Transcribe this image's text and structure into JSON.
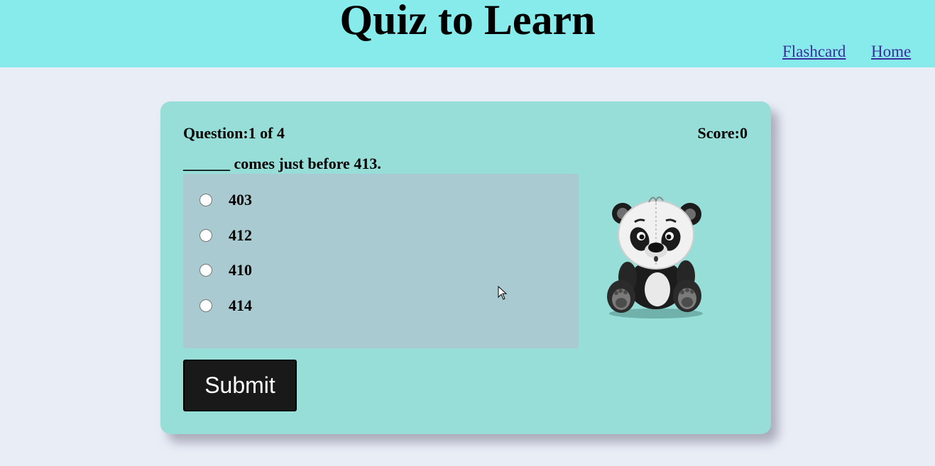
{
  "header": {
    "title": "Quiz to Learn",
    "nav": {
      "flashcard": "Flashcard",
      "home": "Home"
    }
  },
  "quiz": {
    "counter": "Question:1 of 4",
    "score": "Score:0",
    "question": "______ comes just before 413.",
    "options": [
      "403",
      "412",
      "410",
      "414"
    ],
    "submit_label": "Submit",
    "mascot_icon": "panda-icon"
  },
  "colors": {
    "header_bg": "#87ebeb",
    "page_bg": "#e9edf6",
    "card_bg": "#97ddd8",
    "options_bg": "#a9cad0",
    "submit_bg": "#1a1919",
    "link": "#3d2e9e"
  }
}
